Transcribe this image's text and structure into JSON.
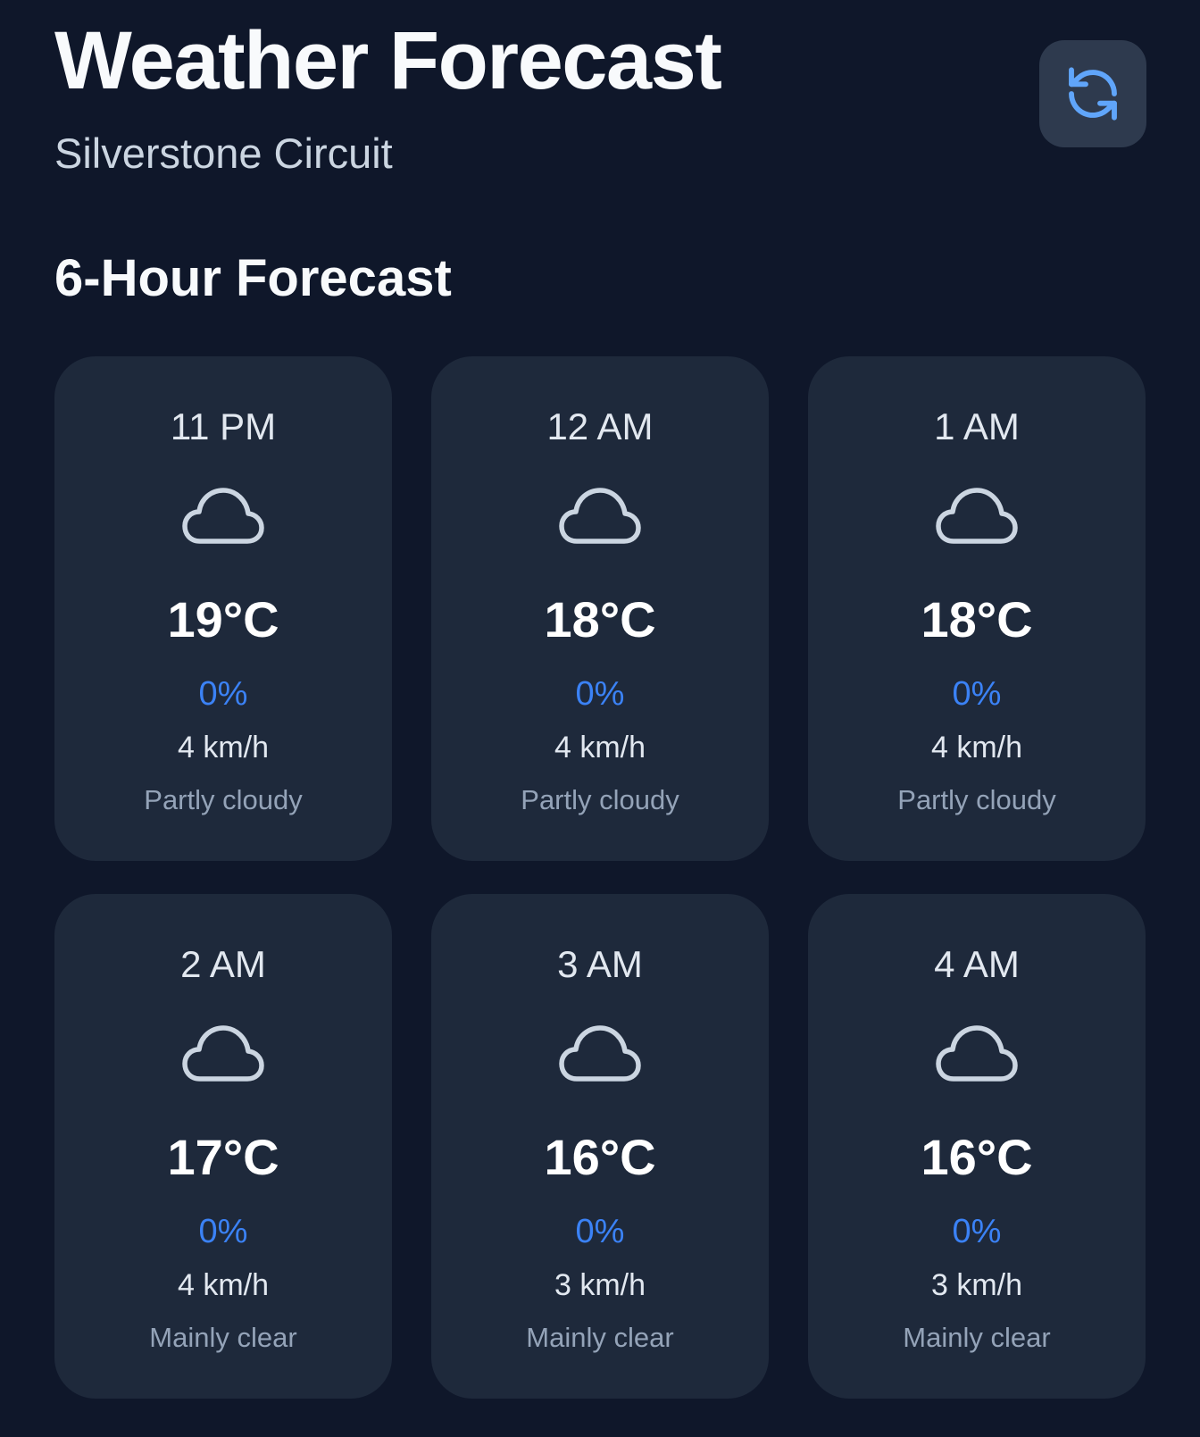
{
  "header": {
    "title": "Weather Forecast",
    "location": "Silverstone Circuit",
    "refresh_icon": "refresh-icon"
  },
  "section": {
    "title": "6-Hour Forecast"
  },
  "colors": {
    "background": "#0f172a",
    "card": "#1e293b",
    "precip_accent": "#3b82f6",
    "refresh_icon": "#60a5fa"
  },
  "forecast": [
    {
      "time": "11 PM",
      "icon": "cloud-icon",
      "temp": "19°C",
      "precip": "0%",
      "wind": "4 km/h",
      "condition": "Partly cloudy"
    },
    {
      "time": "12 AM",
      "icon": "cloud-icon",
      "temp": "18°C",
      "precip": "0%",
      "wind": "4 km/h",
      "condition": "Partly cloudy"
    },
    {
      "time": "1 AM",
      "icon": "cloud-icon",
      "temp": "18°C",
      "precip": "0%",
      "wind": "4 km/h",
      "condition": "Partly cloudy"
    },
    {
      "time": "2 AM",
      "icon": "cloud-icon",
      "temp": "17°C",
      "precip": "0%",
      "wind": "4 km/h",
      "condition": "Mainly clear"
    },
    {
      "time": "3 AM",
      "icon": "cloud-icon",
      "temp": "16°C",
      "precip": "0%",
      "wind": "3 km/h",
      "condition": "Mainly clear"
    },
    {
      "time": "4 AM",
      "icon": "cloud-icon",
      "temp": "16°C",
      "precip": "0%",
      "wind": "3 km/h",
      "condition": "Mainly clear"
    }
  ]
}
